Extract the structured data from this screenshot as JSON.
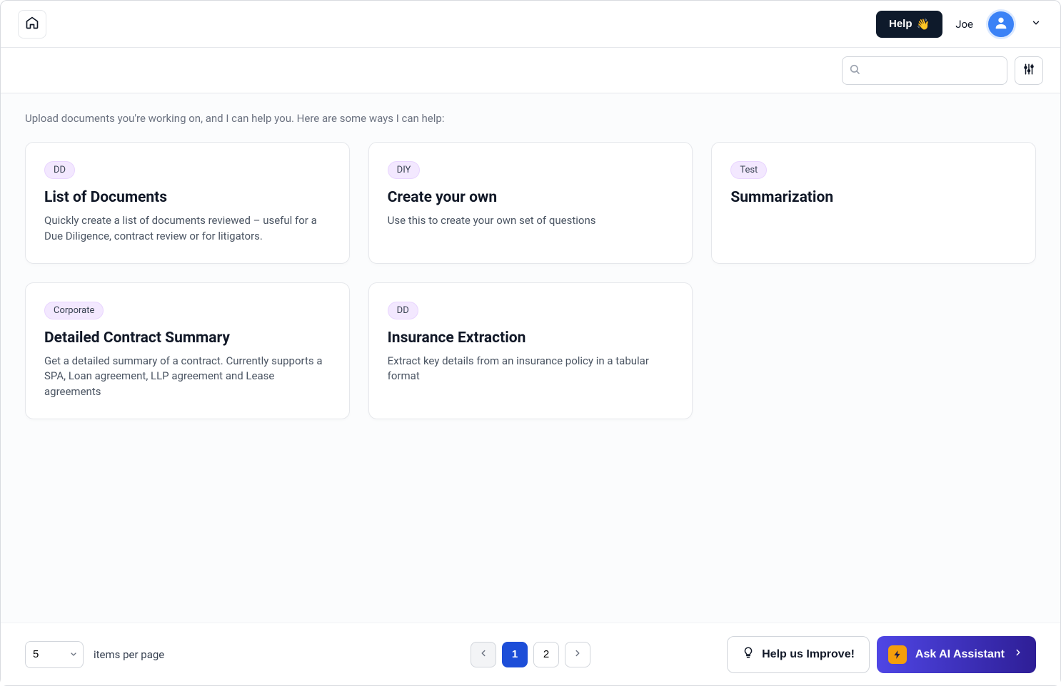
{
  "header": {
    "help_label": "Help",
    "help_emoji": "👋",
    "username": "Joe"
  },
  "search": {
    "placeholder": ""
  },
  "main": {
    "intro": "Upload documents you're working on, and I can help you. Here are some ways I can help:",
    "cards": [
      {
        "badge": "DD",
        "title": "List of Documents",
        "desc": "Quickly create a list of documents reviewed – useful for a Due Diligence, contract review or for litigators."
      },
      {
        "badge": "DIY",
        "title": "Create your own",
        "desc": "Use this to create your own set of questions"
      },
      {
        "badge": "Test",
        "title": "Summarization",
        "desc": ""
      },
      {
        "badge": "Corporate",
        "title": "Detailed Contract Summary",
        "desc": "Get a detailed summary of a contract. Currently supports a SPA, Loan agreement, LLP agreement and Lease agreements"
      },
      {
        "badge": "DD",
        "title": "Insurance Extraction",
        "desc": "Extract key details from an insurance policy in a tabular format"
      }
    ]
  },
  "footer": {
    "page_size": "5",
    "items_per_page_label": "items per page",
    "pages": [
      "1",
      "2"
    ],
    "current_page": "1",
    "improve_label": "Help us Improve!",
    "ask_ai_label": "Ask AI Assistant"
  }
}
